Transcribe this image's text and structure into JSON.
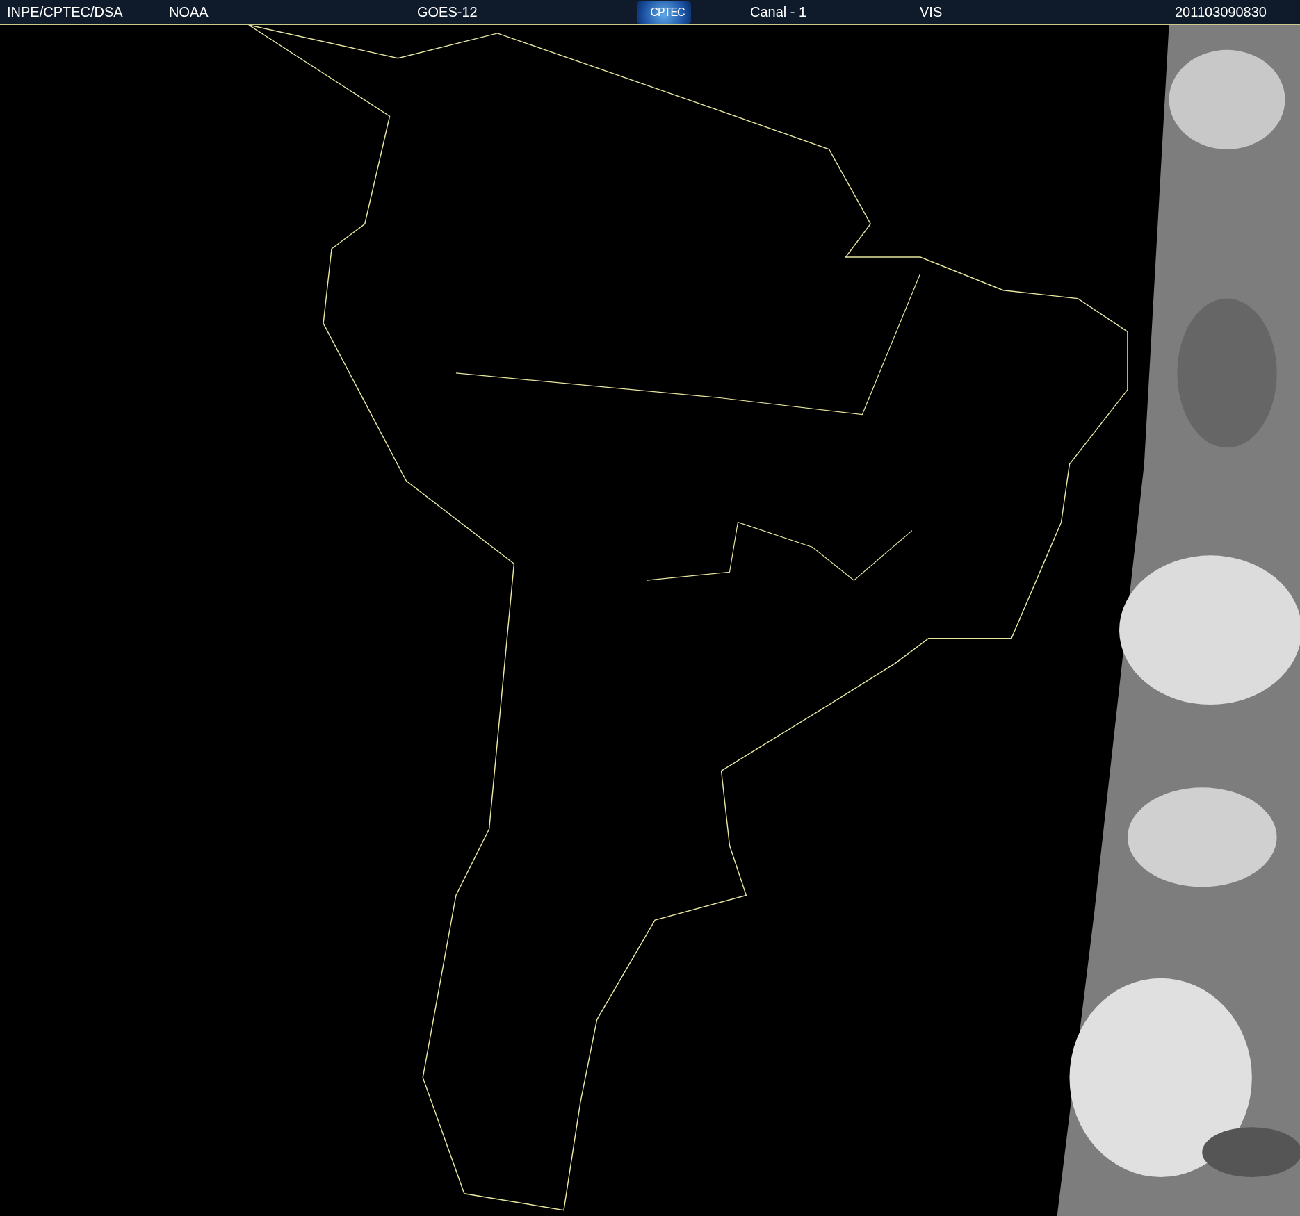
{
  "header": {
    "agency": "INPE/CPTEC/DSA",
    "source": "NOAA",
    "satellite": "GOES-12",
    "logo": "CPTEC",
    "channel": "Canal - 1",
    "band": "VIS",
    "timestamp": "201103090830"
  }
}
